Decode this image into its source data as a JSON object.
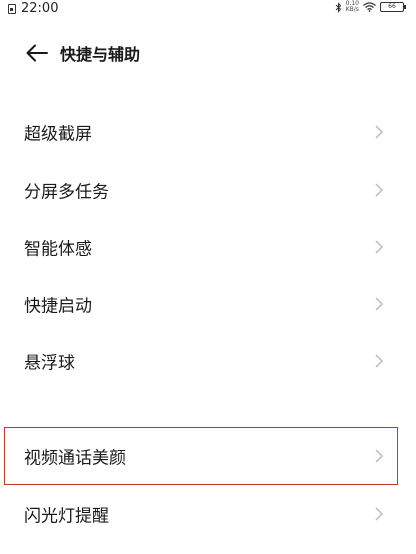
{
  "status_bar": {
    "time": "22:00",
    "net_speed_value": "0.10",
    "net_speed_unit": "KB/s",
    "battery": "66"
  },
  "header": {
    "title": "快捷与辅助"
  },
  "items": [
    {
      "label": "超级截屏"
    },
    {
      "label": "分屏多任务"
    },
    {
      "label": "智能体感"
    },
    {
      "label": "快捷启动"
    },
    {
      "label": "悬浮球"
    },
    {
      "label": "视频通话美颜"
    },
    {
      "label": "闪光灯提醒"
    }
  ],
  "colors": {
    "highlight_border": "#c0392b",
    "chevron": "#bbbbbb",
    "text": "#1a1a1a"
  },
  "icons": {
    "back": "arrow-left-icon",
    "chevron": "chevron-right-icon",
    "bluetooth": "bluetooth-icon",
    "wifi": "wifi-icon",
    "battery": "battery-icon",
    "sim": "sim-icon"
  }
}
